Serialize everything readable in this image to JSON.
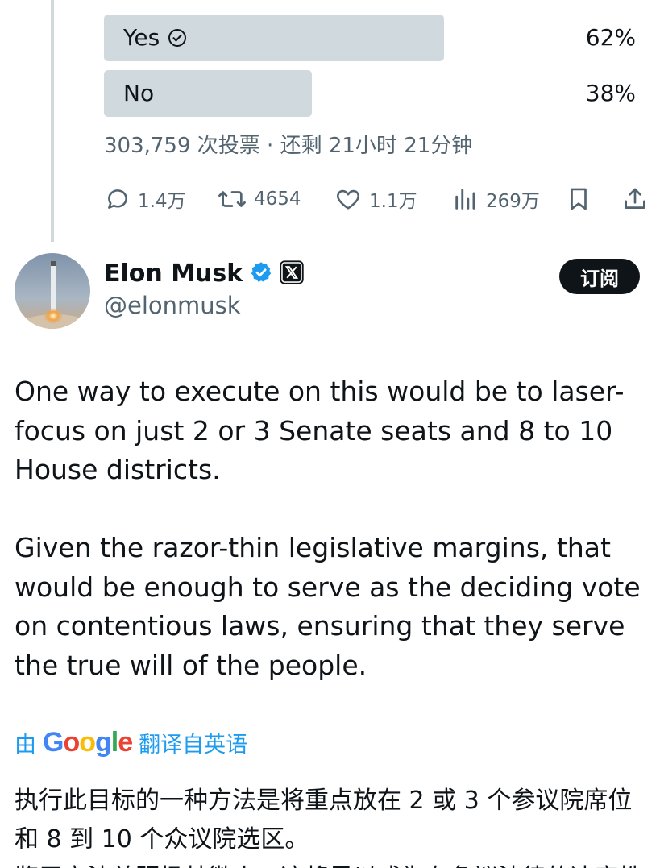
{
  "poll": {
    "options": [
      {
        "label": "Yes",
        "percent": "62%",
        "fraction": 0.62
      },
      {
        "label": "No",
        "percent": "38%",
        "fraction": 0.38
      }
    ],
    "meta": "303,759 次投票 · 还剩 21小时 21分钟"
  },
  "parent_actions": {
    "replies": "1.4万",
    "retweets": "4654",
    "likes": "1.1万",
    "views": "269万"
  },
  "tweet": {
    "display_name": "Elon Musk",
    "handle": "@elonmusk",
    "subscribe_label": "订阅",
    "paragraphs": [
      "One way to execute on this would be to laser-focus on just 2 or 3 Senate seats and 8 to 10 House districts.",
      "Given the razor-thin legislative margins, that would be enough to serve as the deciding vote on contentious laws, ensuring that they serve the true will of the people."
    ]
  },
  "translation": {
    "prefix": "由",
    "brand": "Google",
    "suffix": "翻译自英语",
    "text": "执行此目标的一种方法是将重点放在 2 或 3 个参议院席位和 8 到 10 个众议院选区。",
    "partial_next_line": "鉴于立法差距极其微小，这将足以成为有争议法律的决定性一票，确保它们体现人民的真实意愿。"
  },
  "colors": {
    "poll_bar": "#cfd9de",
    "secondary_text": "#536471",
    "link_blue": "#1d9bf0",
    "verified_blue": "#1d9bf0",
    "primary_text": "#0f1419"
  }
}
